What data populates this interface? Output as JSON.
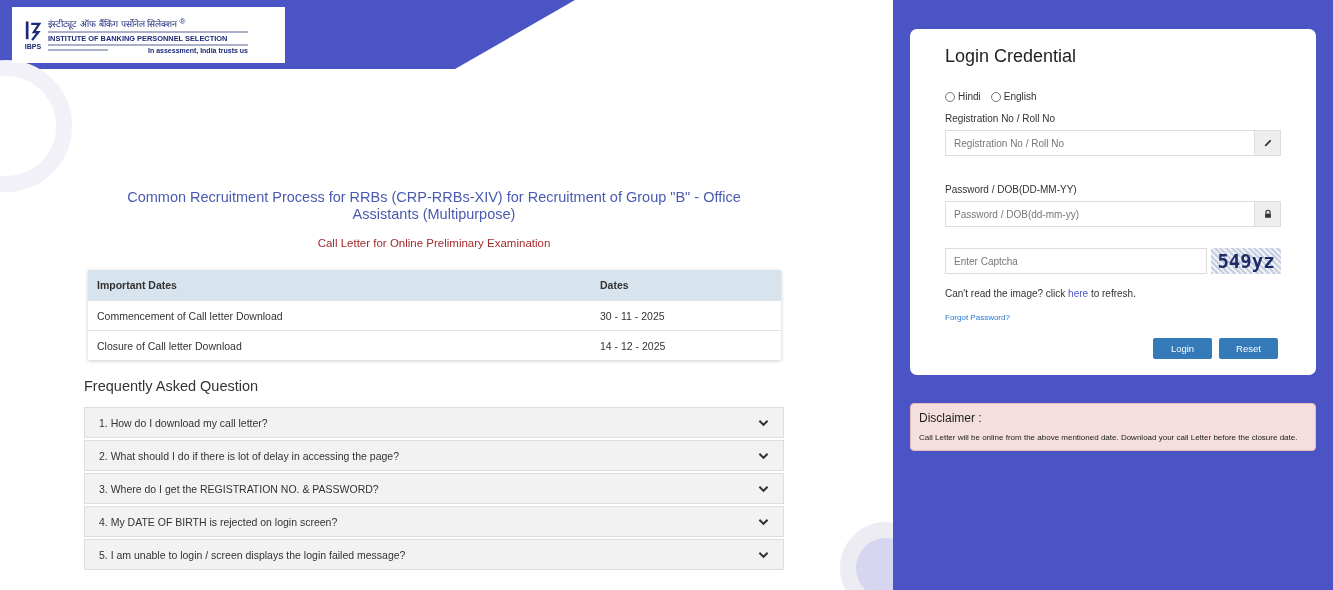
{
  "logo": {
    "hindi_name": "इंस्टीट्यूट ऑफ बैंकिंग पर्सोनेल सिलेक्शन",
    "registered": "®",
    "english_name": "INSTITUTE OF BANKING PERSONNEL SELECTION",
    "abbr": "IBPS",
    "tagline": "In assessment, India trusts us"
  },
  "title": "Common Recruitment Process for RRBs (CRP-RRBs-XIV) for Recruitment of Group \"B\" - Office Assistants (Multipurpose)",
  "subtitle": "Call Letter for Online Preliminary Examination",
  "dates_table": {
    "columns": [
      "Important Dates",
      "Dates"
    ],
    "rows": [
      [
        "Commencement of Call letter Download",
        "30 - 11 - 2025"
      ],
      [
        "Closure of Call letter Download",
        "14 - 12 - 2025"
      ]
    ]
  },
  "faq": {
    "heading": "Frequently Asked Question",
    "items": [
      {
        "question": "1. How do I download my call letter?",
        "expanded": false
      },
      {
        "question": "2. What should I do if there is lot of delay in accessing the page?",
        "expanded": false
      },
      {
        "question": "3. Where do I get the REGISTRATION NO. & PASSWORD?",
        "expanded": false
      },
      {
        "question": "4. My DATE OF BIRTH is rejected on login screen?",
        "expanded": false
      },
      {
        "question": "5. I am unable to login / screen displays the login failed message?",
        "expanded": false
      }
    ]
  },
  "login": {
    "heading": "Login Credential",
    "languages": [
      {
        "label": "Hindi",
        "selected": false
      },
      {
        "label": "English",
        "selected": false
      }
    ],
    "fields": [
      {
        "label": "Registration No / Roll No",
        "placeholder": "Registration No / Roll No",
        "kind": "edit"
      },
      {
        "label": "Password / DOB(DD-MM-YY)",
        "placeholder": "Password / DOB(dd-mm-yy)",
        "kind": "lock"
      }
    ],
    "captcha": {
      "placeholder": "Enter Captcha",
      "code": "549yz"
    },
    "refresh_before": "Can't read the image? click",
    "refresh_link": "here",
    "refresh_after": "to refresh.",
    "forgot": "Forgot Password?",
    "buttons": [
      "Login",
      "Reset"
    ]
  },
  "disclaimer": {
    "heading": "Disclaimer :",
    "text": "Call Letter will be online from the above mentioned date. Download your call Letter before the closure date."
  }
}
